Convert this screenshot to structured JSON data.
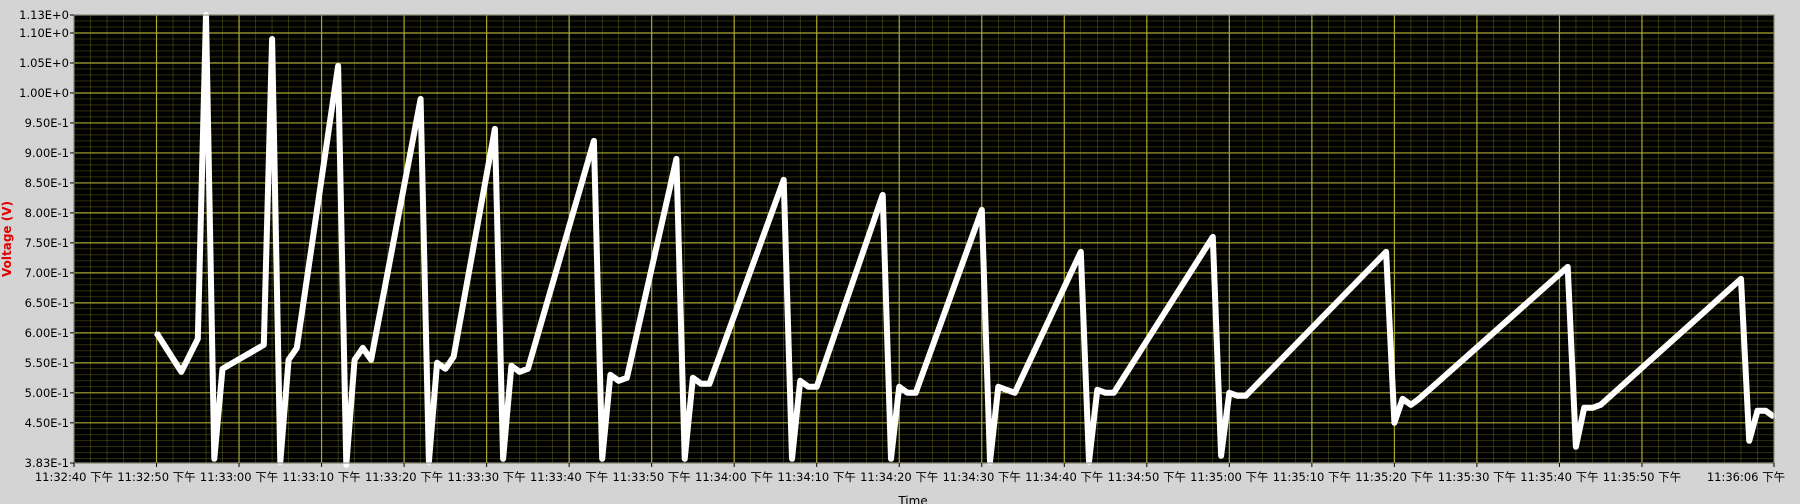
{
  "chart_data": {
    "type": "line",
    "title": "",
    "xlabel": "Time",
    "ylabel": "Voltage (V)",
    "ylim": [
      0.383,
      1.13
    ],
    "y_ticks": [
      0.383,
      0.45,
      0.5,
      0.55,
      0.6,
      0.65,
      0.7,
      0.75,
      0.8,
      0.85,
      0.9,
      0.95,
      1.0,
      1.05,
      1.1,
      1.13
    ],
    "y_tick_labels": [
      "3.83E-1",
      "4.50E-1",
      "5.00E-1",
      "5.50E-1",
      "6.00E-1",
      "6.50E-1",
      "7.00E-1",
      "7.50E-1",
      "8.00E-1",
      "8.50E-1",
      "9.00E-1",
      "9.50E-1",
      "1.00E+0",
      "1.05E+0",
      "1.10E+0",
      "1.13E+0"
    ],
    "xlim": [
      "11:32:40",
      "11:36:06"
    ],
    "x_tick_labels": [
      "11:32:40 下午",
      "11:32:50 下午",
      "11:33:00 下午",
      "11:33:10 下午",
      "11:33:20 下午",
      "11:33:30 下午",
      "11:33:40 下午",
      "11:33:50 下午",
      "11:34:00 下午",
      "11:34:10 下午",
      "11:34:20 下午",
      "11:34:30 下午",
      "11:34:40 下午",
      "11:34:50 下午",
      "11:35:00 下午",
      "11:35:10 下午",
      "11:35:20 下午",
      "11:35:30 下午",
      "11:35:40 下午",
      "11:35:50 下午",
      "11:36:06 下午"
    ],
    "grid": true,
    "colors": {
      "plot_background": "#000000",
      "grid": "#a8a832",
      "trace": "#ffffff",
      "frame": "#d4d4d4",
      "ylabel": "#e00000"
    },
    "series": [
      {
        "x": [
          "11:32:50",
          "11:32:53",
          "11:32:55",
          "11:32:56",
          "11:32:57",
          "11:32:58",
          "11:33:03",
          "11:33:04",
          "11:33:05",
          "11:33:06",
          "11:33:07",
          "11:33:12",
          "11:33:13",
          "11:33:14",
          "11:33:15",
          "11:33:16",
          "11:33:22",
          "11:33:23",
          "11:33:24",
          "11:33:25",
          "11:33:26",
          "11:33:31",
          "11:33:32",
          "11:33:33",
          "11:33:34",
          "11:33:35",
          "11:33:43",
          "11:33:44",
          "11:33:45",
          "11:33:46",
          "11:33:47",
          "11:33:53",
          "11:33:54",
          "11:33:55",
          "11:33:56",
          "11:33:57",
          "11:34:06",
          "11:34:07",
          "11:34:08",
          "11:34:09",
          "11:34:10",
          "11:34:18",
          "11:34:19",
          "11:34:20",
          "11:34:21",
          "11:34:22",
          "11:34:30",
          "11:34:31",
          "11:34:32",
          "11:34:33",
          "11:34:34",
          "11:34:42",
          "11:34:43",
          "11:34:44",
          "11:34:45",
          "11:34:46",
          "11:34:58",
          "11:34:59",
          "11:35:00",
          "11:35:01",
          "11:35:02",
          "11:35:19",
          "11:35:20",
          "11:35:21",
          "11:35:22",
          "11:35:23",
          "11:35:41",
          "11:35:42",
          "11:35:43",
          "11:35:44",
          "11:35:45",
          "11:36:02",
          "11:36:03",
          "11:36:04",
          "11:36:05",
          "11:36:06"
        ],
        "values": [
          0.6,
          0.535,
          0.59,
          1.13,
          0.39,
          0.54,
          0.58,
          1.09,
          0.385,
          0.555,
          0.575,
          1.045,
          0.38,
          0.555,
          0.575,
          0.555,
          0.99,
          0.385,
          0.55,
          0.54,
          0.56,
          0.94,
          0.39,
          0.545,
          0.535,
          0.54,
          0.92,
          0.39,
          0.53,
          0.52,
          0.525,
          0.89,
          0.39,
          0.525,
          0.515,
          0.515,
          0.855,
          0.39,
          0.52,
          0.51,
          0.51,
          0.83,
          0.39,
          0.51,
          0.5,
          0.5,
          0.805,
          0.385,
          0.51,
          0.505,
          0.5,
          0.735,
          0.385,
          0.505,
          0.5,
          0.5,
          0.76,
          0.395,
          0.5,
          0.495,
          0.495,
          0.735,
          0.45,
          0.49,
          0.48,
          0.49,
          0.71,
          0.41,
          0.475,
          0.475,
          0.48,
          0.69,
          0.42,
          0.47,
          0.47,
          0.46
        ]
      }
    ]
  }
}
